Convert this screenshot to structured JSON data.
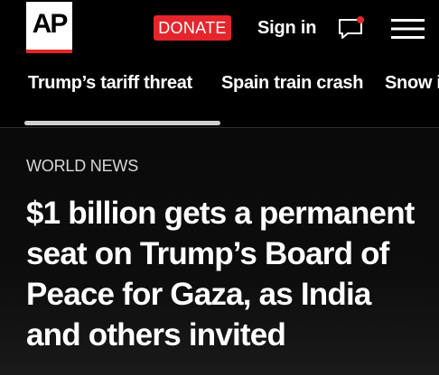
{
  "header": {
    "logo_text": "AP",
    "donate_label": "DONATE",
    "signin_label": "Sign in",
    "chat_icon": "chat-bubble-icon",
    "menu_icon": "hamburger-menu-icon"
  },
  "trending": {
    "items": [
      {
        "label": "Trump’s tariff threat"
      },
      {
        "label": "Spain train crash"
      },
      {
        "label": "Snow i"
      }
    ]
  },
  "article": {
    "category": "WORLD NEWS",
    "headline": "$1 billion gets a permanent seat on Trump’s Board of Peace for Gaza, as India and others invited"
  },
  "colors": {
    "brand_red": "#e4262c",
    "background": "#000000",
    "text": "#ffffff"
  }
}
